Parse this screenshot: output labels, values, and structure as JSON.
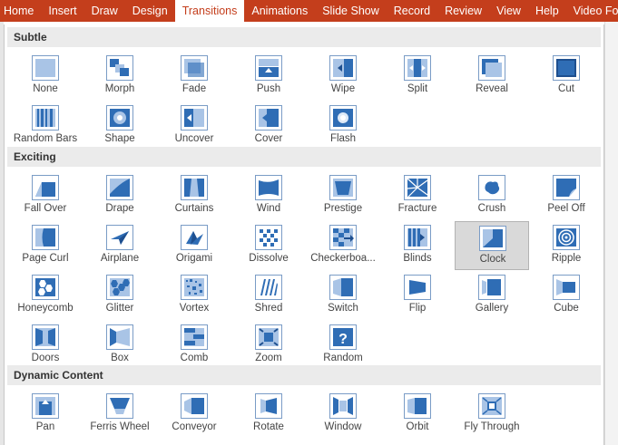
{
  "ribbon": {
    "tabs": [
      "Home",
      "Insert",
      "Draw",
      "Design",
      "Transitions",
      "Animations",
      "Slide Show",
      "Record",
      "Review",
      "View",
      "Help",
      "Video Forma"
    ],
    "active": "Transitions"
  },
  "colors": {
    "ribbon": "#c43e1c",
    "icon_fill": "#2f6db5",
    "icon_light": "#a9c4e6",
    "selected_tile": "#d9d9d9"
  },
  "sections": [
    {
      "title": "Subtle",
      "items": [
        {
          "label": "None",
          "icon": "none-icon"
        },
        {
          "label": "Morph",
          "icon": "morph-icon"
        },
        {
          "label": "Fade",
          "icon": "fade-icon"
        },
        {
          "label": "Push",
          "icon": "push-icon"
        },
        {
          "label": "Wipe",
          "icon": "wipe-icon"
        },
        {
          "label": "Split",
          "icon": "split-icon"
        },
        {
          "label": "Reveal",
          "icon": "reveal-icon"
        },
        {
          "label": "Cut",
          "icon": "cut-icon"
        },
        {
          "label": "Random Bars",
          "icon": "random-bars-icon"
        },
        {
          "label": "Shape",
          "icon": "shape-icon"
        },
        {
          "label": "Uncover",
          "icon": "uncover-icon"
        },
        {
          "label": "Cover",
          "icon": "cover-icon"
        },
        {
          "label": "Flash",
          "icon": "flash-icon"
        }
      ]
    },
    {
      "title": "Exciting",
      "items": [
        {
          "label": "Fall Over",
          "icon": "fall-over-icon"
        },
        {
          "label": "Drape",
          "icon": "drape-icon"
        },
        {
          "label": "Curtains",
          "icon": "curtains-icon"
        },
        {
          "label": "Wind",
          "icon": "wind-icon"
        },
        {
          "label": "Prestige",
          "icon": "prestige-icon"
        },
        {
          "label": "Fracture",
          "icon": "fracture-icon"
        },
        {
          "label": "Crush",
          "icon": "crush-icon"
        },
        {
          "label": "Peel Off",
          "icon": "peel-off-icon"
        },
        {
          "label": "Page Curl",
          "icon": "page-curl-icon"
        },
        {
          "label": "Airplane",
          "icon": "airplane-icon"
        },
        {
          "label": "Origami",
          "icon": "origami-icon"
        },
        {
          "label": "Dissolve",
          "icon": "dissolve-icon"
        },
        {
          "label": "Checkerboa...",
          "icon": "checkerboard-icon"
        },
        {
          "label": "Blinds",
          "icon": "blinds-icon"
        },
        {
          "label": "Clock",
          "icon": "clock-icon",
          "selected": true
        },
        {
          "label": "Ripple",
          "icon": "ripple-icon"
        },
        {
          "label": "Honeycomb",
          "icon": "honeycomb-icon"
        },
        {
          "label": "Glitter",
          "icon": "glitter-icon"
        },
        {
          "label": "Vortex",
          "icon": "vortex-icon"
        },
        {
          "label": "Shred",
          "icon": "shred-icon"
        },
        {
          "label": "Switch",
          "icon": "switch-icon"
        },
        {
          "label": "Flip",
          "icon": "flip-icon"
        },
        {
          "label": "Gallery",
          "icon": "gallery-icon"
        },
        {
          "label": "Cube",
          "icon": "cube-icon"
        },
        {
          "label": "Doors",
          "icon": "doors-icon"
        },
        {
          "label": "Box",
          "icon": "box-icon"
        },
        {
          "label": "Comb",
          "icon": "comb-icon"
        },
        {
          "label": "Zoom",
          "icon": "zoom-icon"
        },
        {
          "label": "Random",
          "icon": "random-icon"
        }
      ]
    },
    {
      "title": "Dynamic Content",
      "items": [
        {
          "label": "Pan",
          "icon": "pan-icon"
        },
        {
          "label": "Ferris Wheel",
          "icon": "ferris-wheel-icon"
        },
        {
          "label": "Conveyor",
          "icon": "conveyor-icon"
        },
        {
          "label": "Rotate",
          "icon": "rotate-icon"
        },
        {
          "label": "Window",
          "icon": "window-icon"
        },
        {
          "label": "Orbit",
          "icon": "orbit-icon"
        },
        {
          "label": "Fly Through",
          "icon": "fly-through-icon"
        }
      ]
    }
  ]
}
